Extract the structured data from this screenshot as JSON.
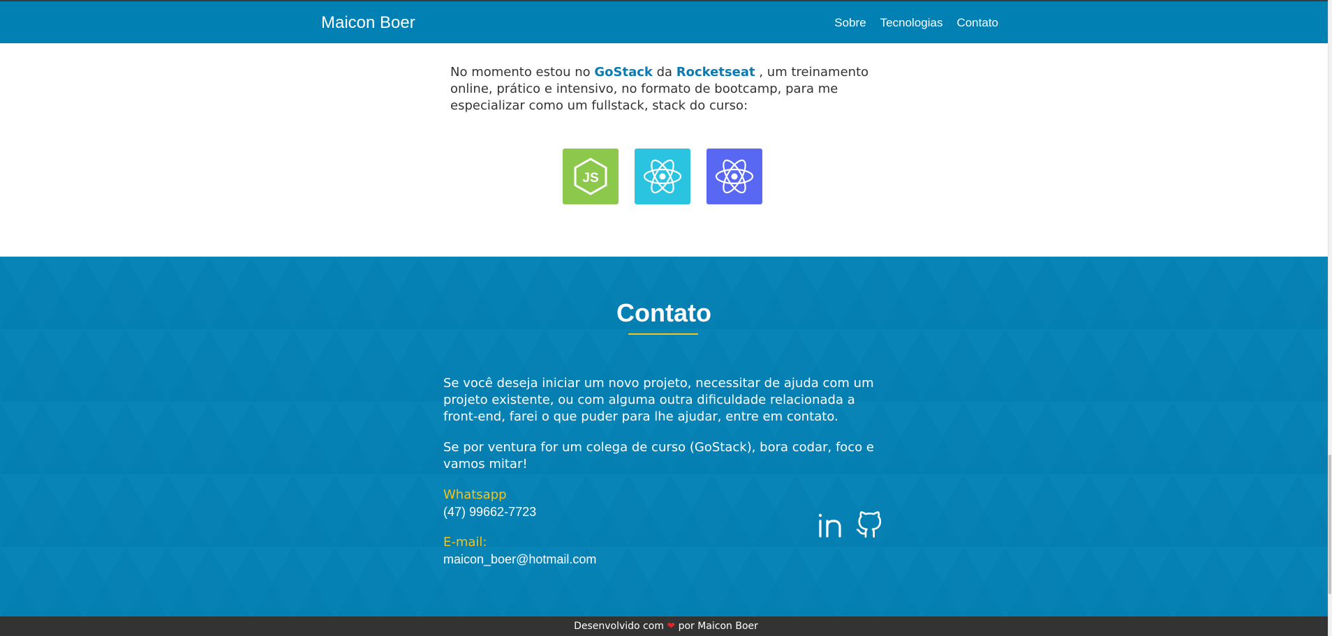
{
  "navbar": {
    "brand": "Maicon Boer",
    "links": [
      "Sobre",
      "Tecnologias",
      "Contato"
    ]
  },
  "tech": {
    "intro_prefix": "No momento estou no ",
    "gostack": "GoStack",
    "da": " da ",
    "rocketseat": "Rocketseat",
    "intro_suffix": " , um treinamento online, prático e intensivo, no formato de bootcamp, para me especializar como um fullstack, stack do curso:",
    "icons": [
      {
        "name": "nodejs-icon",
        "color": "#8cc84b"
      },
      {
        "name": "react-icon",
        "color": "#2bc4e0"
      },
      {
        "name": "react-native-icon",
        "color": "#5968f2"
      }
    ]
  },
  "contact": {
    "title": "Contato",
    "paragraph1": "Se você deseja iniciar um novo projeto, necessitar de ajuda com um projeto existente, ou com alguma outra dificuldade relacionada a front-end, farei o que puder para lhe ajudar, entre em contato.",
    "paragraph2": "Se por ventura for um colega de curso (GoStack), bora codar, foco e vamos mitar!",
    "whatsapp_label": "Whatsapp",
    "whatsapp_value": "(47) 99662-7723",
    "email_label": "E-mail:",
    "email_value": "maicon_boer@hotmail.com",
    "social": [
      "linkedin-icon",
      "github-icon"
    ],
    "background": "#0681b4",
    "accent": "#f5c518"
  },
  "footer": {
    "before_heart": "Desenvolvido com ",
    "after_heart": " por Maicon Boer"
  }
}
